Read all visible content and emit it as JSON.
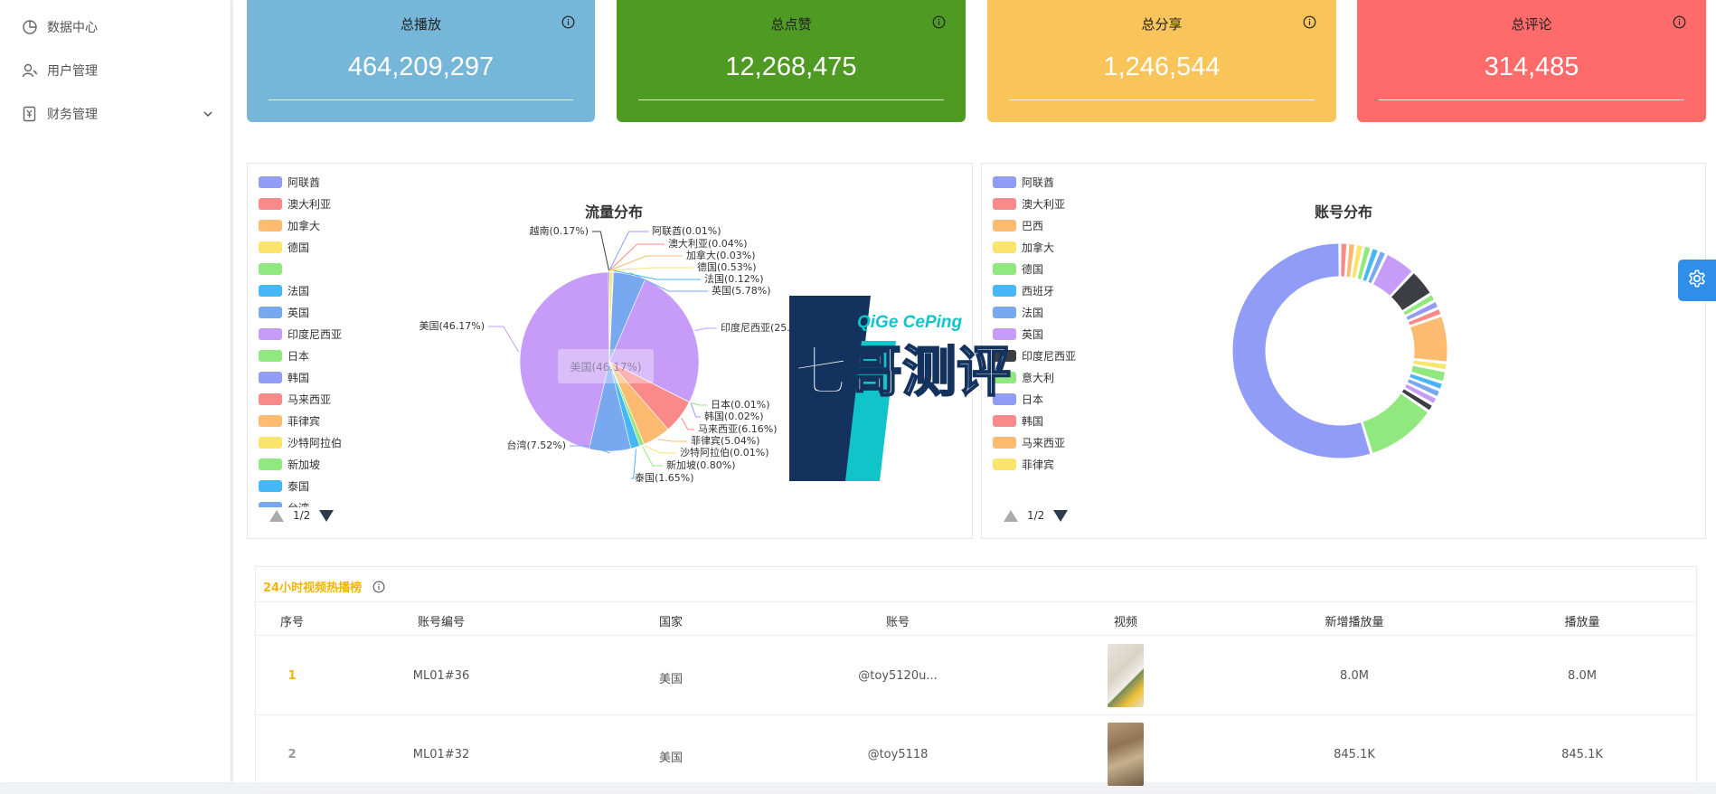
{
  "sidebar": {
    "items": [
      {
        "label": "数据中心",
        "icon": "pie-chart-icon"
      },
      {
        "label": "用户管理",
        "icon": "user-key-icon"
      },
      {
        "label": "财务管理",
        "icon": "finance-icon"
      }
    ]
  },
  "stats": [
    {
      "title": "总播放",
      "value": "464,209,297",
      "color": "#76b7d9"
    },
    {
      "title": "总点赞",
      "value": "12,268,475",
      "color": "#4f9a22"
    },
    {
      "title": "总分享",
      "value": "1,246,544",
      "color": "#f9c45a"
    },
    {
      "title": "总评论",
      "value": "314,485",
      "color": "#ff6b6b"
    }
  ],
  "traffic_panel": {
    "title": "流量分布",
    "legend": [
      "阿联酋",
      "澳大利亚",
      "加拿大",
      "德国",
      "",
      "法国",
      "英国",
      "印度尼西亚",
      "日本",
      "韩国",
      "马来西亚",
      "菲律宾",
      "沙特阿拉伯",
      "新加坡",
      "泰国",
      "台湾"
    ],
    "legend_colors": [
      "#919cf7",
      "#fa8a8a",
      "#fdbb72",
      "#fae56c",
      "#90e87f",
      "#45b7f7",
      "#78a8ef",
      "#c79cf8",
      "#90e87f",
      "#919cf7",
      "#fa8a8a",
      "#fdbb72",
      "#fae56c",
      "#90e87f",
      "#45b7f7",
      "#78a8ef"
    ],
    "pager": "1/2",
    "tooltip": "美国(46.17%)"
  },
  "account_panel": {
    "title": "账号分布",
    "legend": [
      "阿联酋",
      "澳大利亚",
      "巴西",
      "加拿大",
      "德国",
      "西班牙",
      "法国",
      "英国",
      "印度尼西亚",
      "意大利",
      "日本",
      "韩国",
      "马来西亚",
      "菲律宾"
    ],
    "legend_colors": [
      "#919cf7",
      "#fa8a8a",
      "#fdbb72",
      "#fae56c",
      "#90e87f",
      "#45b7f7",
      "#78a8ef",
      "#c79cf8",
      "#3d3d44",
      "#90e87f",
      "#919cf7",
      "#fa8a8a",
      "#fdbb72",
      "#fae56c"
    ],
    "pager": "1/2"
  },
  "chart_data": [
    {
      "type": "pie",
      "title": "流量分布",
      "slices": [
        {
          "label": "阿联酋(0.01%)",
          "value": 0.01,
          "color": "#919cf7"
        },
        {
          "label": "澳大利亚(0.04%)",
          "value": 0.04,
          "color": "#fa8a8a"
        },
        {
          "label": "加拿大(0.03%)",
          "value": 0.03,
          "color": "#fdbb72"
        },
        {
          "label": "德国(0.53%)",
          "value": 0.53,
          "color": "#fae56c"
        },
        {
          "label": "法国(0.12%)",
          "value": 0.12,
          "color": "#45b7f7"
        },
        {
          "label": "英国(5.78%)",
          "value": 5.78,
          "color": "#78a8ef"
        },
        {
          "label": "印度尼西亚(25.",
          "value": 25.9,
          "color": "#c79cf8"
        },
        {
          "label": "日本(0.01%)",
          "value": 0.01,
          "color": "#90e87f"
        },
        {
          "label": "韩国(0.02%)",
          "value": 0.02,
          "color": "#919cf7"
        },
        {
          "label": "马来西亚(6.16%)",
          "value": 6.16,
          "color": "#fa8a8a"
        },
        {
          "label": "菲律宾(5.04%)",
          "value": 5.04,
          "color": "#fdbb72"
        },
        {
          "label": "沙特阿拉伯(0.01%)",
          "value": 0.01,
          "color": "#fae56c"
        },
        {
          "label": "新加坡(0.80%)",
          "value": 0.8,
          "color": "#90e87f"
        },
        {
          "label": "泰国(1.65%)",
          "value": 1.65,
          "color": "#45b7f7"
        },
        {
          "label": "台湾(7.52%)",
          "value": 7.52,
          "color": "#78a8ef"
        },
        {
          "label": "美国(46.17%)",
          "value": 46.17,
          "color": "#c79cf8"
        },
        {
          "label": "越南(0.17%)",
          "value": 0.17,
          "color": "#3d3d44"
        }
      ]
    },
    {
      "type": "pie",
      "title": "账号分布",
      "slices": [
        {
          "value": 1,
          "color": "#fa8a8a"
        },
        {
          "value": 1,
          "color": "#fdbb72"
        },
        {
          "value": 1,
          "color": "#fae56c"
        },
        {
          "value": 1,
          "color": "#90e87f"
        },
        {
          "value": 1,
          "color": "#45b7f7"
        },
        {
          "value": 1,
          "color": "#78a8ef"
        },
        {
          "value": 4,
          "color": "#c79cf8"
        },
        {
          "value": 3.5,
          "color": "#3d3d44"
        },
        {
          "value": 1,
          "color": "#90e87f"
        },
        {
          "value": 1,
          "color": "#919cf7"
        },
        {
          "value": 1,
          "color": "#fa8a8a"
        },
        {
          "value": 6,
          "color": "#fdbb72"
        },
        {
          "value": 1,
          "color": "#fae56c"
        },
        {
          "value": 1.5,
          "color": "#90e87f"
        },
        {
          "value": 1,
          "color": "#45b7f7"
        },
        {
          "value": 1,
          "color": "#78a8ef"
        },
        {
          "value": 1,
          "color": "#c79cf8"
        },
        {
          "value": 1,
          "color": "#3d3d44"
        },
        {
          "value": 9,
          "color": "#90e87f"
        },
        {
          "value": 46,
          "color": "#919cf7"
        }
      ]
    }
  ],
  "hot_table": {
    "title": "24小时视频热播榜",
    "columns": [
      "序号",
      "账号编号",
      "国家",
      "账号",
      "视频",
      "新增播放量",
      "播放量"
    ],
    "rows": [
      {
        "rank": "1",
        "account_id": "ML01#36",
        "country": "美国",
        "account": "@toy5120u...",
        "new_plays": "8.0M",
        "plays": "8.0M"
      },
      {
        "rank": "2",
        "account_id": "ML01#32",
        "country": "美国",
        "account": "@toy5118",
        "new_plays": "845.1K",
        "plays": "845.1K"
      }
    ]
  },
  "watermark": {
    "latin": "QiGe CePing",
    "chinese": "七哥测评"
  }
}
